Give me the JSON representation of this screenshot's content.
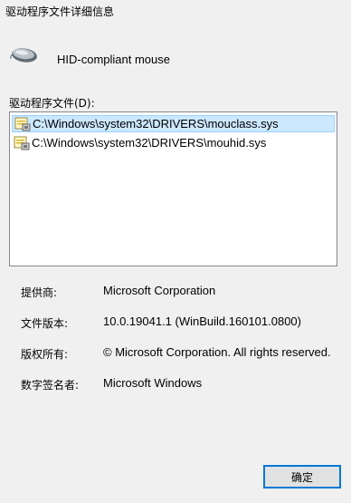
{
  "window": {
    "title": "驱动程序文件详细信息"
  },
  "device": {
    "name": "HID-compliant mouse",
    "icon": "mouse-icon"
  },
  "files": {
    "label": "驱动程序文件(D):",
    "items": [
      {
        "path": "C:\\Windows\\system32\\DRIVERS\\mouclass.sys",
        "icon": "driver-file-icon",
        "selected": true
      },
      {
        "path": "C:\\Windows\\system32\\DRIVERS\\mouhid.sys",
        "icon": "driver-file-icon",
        "selected": false
      }
    ]
  },
  "details": {
    "provider_label": "提供商:",
    "provider_value": "Microsoft Corporation",
    "version_label": "文件版本:",
    "version_value": "10.0.19041.1 (WinBuild.160101.0800)",
    "copyright_label": "版权所有:",
    "copyright_value": "© Microsoft Corporation. All rights reserved.",
    "signer_label": "数字签名者:",
    "signer_value": "Microsoft Windows"
  },
  "buttons": {
    "ok_label": "确定"
  },
  "colors": {
    "selection_bg": "#cce8ff",
    "selection_border": "#99d1ff",
    "button_focus_border": "#0078d7"
  }
}
